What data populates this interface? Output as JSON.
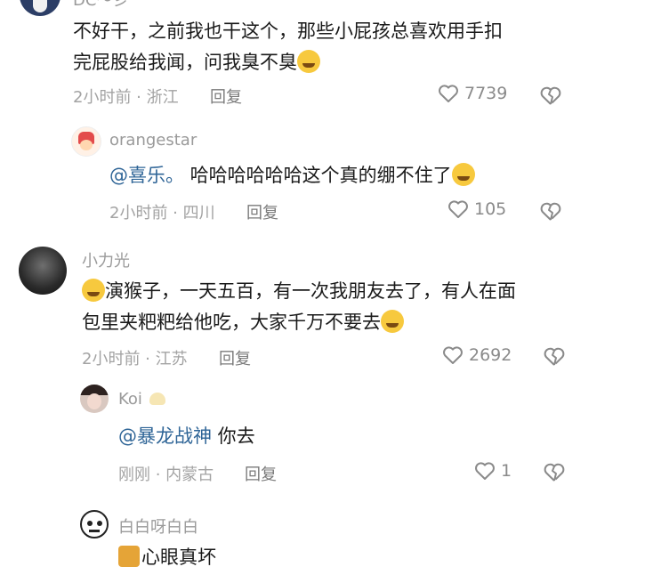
{
  "comments": [
    {
      "username": "DC～彡",
      "text_line1": "不好干，之前我也干这个，那些小屁孩总喜欢用手扣",
      "text_line2": "完屁股给我闻，问我臭不臭",
      "meta": "2小时前 · 浙江",
      "reply_label": "回复",
      "likes": "7739",
      "emoji_end": "crying-face"
    },
    {
      "username": "orangestar",
      "mention": "@喜乐。",
      "text": " 哈哈哈哈哈哈这个真的绷不住了",
      "meta": "2小时前 · 四川",
      "reply_label": "回复",
      "likes": "105",
      "emoji_end": "sweat-smile-face"
    },
    {
      "username": "小力光",
      "text_line1": "演猴子，一天五百，有一次我朋友去了，有人在面",
      "text_line2": "包里夹粑粑给他吃，大家千万不要去",
      "meta": "2小时前 · 江苏",
      "reply_label": "回复",
      "likes": "2692",
      "emoji_start": "rolling-laugh-face",
      "emoji_end": "sweat-smile-face"
    },
    {
      "username": "Koi",
      "mention": "@暴龙战神",
      "text": " 你去",
      "meta": "刚刚 · 内蒙古",
      "reply_label": "回复",
      "likes": "1"
    },
    {
      "username": "白白呀白白",
      "text": "心眼真坏",
      "emoji_start": "cat-sticker"
    }
  ],
  "colors": {
    "mention": "#2f6597",
    "meta": "#a3a3a3",
    "text": "#1a1a1a"
  }
}
